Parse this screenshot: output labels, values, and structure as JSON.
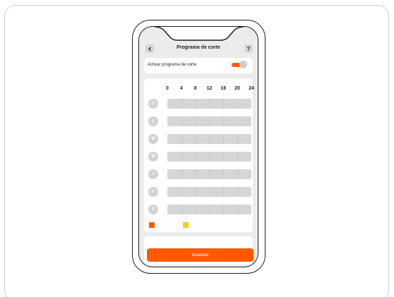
{
  "header": {
    "title": "Programa de corte",
    "back_icon": "chevron-left-icon",
    "help_label": "?"
  },
  "toggle": {
    "label": "Activar programa de corte",
    "state": "on",
    "color": "#ff5a00"
  },
  "schedule": {
    "hours": [
      "0",
      "4",
      "8",
      "12",
      "16",
      "20",
      "24"
    ],
    "days": [
      "D",
      "L",
      "M",
      "M",
      "J",
      "V",
      "S"
    ],
    "legend": [
      {
        "color": "#ff5a00"
      },
      {
        "color": "#ffcc00"
      }
    ]
  },
  "footer": {
    "save_label": "Guardar"
  },
  "colors": {
    "accent": "#ff5a00",
    "secondary": "#ffcc00",
    "bar": "#d6d6d6"
  }
}
